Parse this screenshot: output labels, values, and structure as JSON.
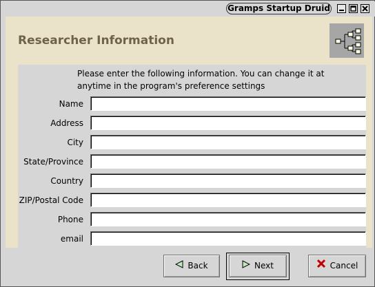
{
  "window": {
    "title": "Gramps Startup Druid"
  },
  "header": {
    "title": "Researcher Information"
  },
  "intro": {
    "line1": "Please enter the following information. You can change it at",
    "line2": "anytime in the program's preference settings"
  },
  "fields": [
    {
      "label": "Name",
      "value": ""
    },
    {
      "label": "Address",
      "value": ""
    },
    {
      "label": "City",
      "value": ""
    },
    {
      "label": "State/Province",
      "value": ""
    },
    {
      "label": "Country",
      "value": ""
    },
    {
      "label": "ZIP/Postal Code",
      "value": ""
    },
    {
      "label": "Phone",
      "value": ""
    },
    {
      "label": "email",
      "value": ""
    }
  ],
  "buttons": {
    "back": "Back",
    "next": "Next",
    "cancel": "Cancel"
  },
  "icons": {
    "minimize": "minimize-icon",
    "maximize": "maximize-icon",
    "close": "close-icon",
    "logo": "family-tree-icon",
    "back": "left-triangle-icon",
    "next": "right-triangle-icon",
    "cancel": "red-x-icon"
  },
  "colors": {
    "header_bg": "#eae2c9",
    "header_text": "#6f624c",
    "cancel_icon": "#c00000"
  }
}
